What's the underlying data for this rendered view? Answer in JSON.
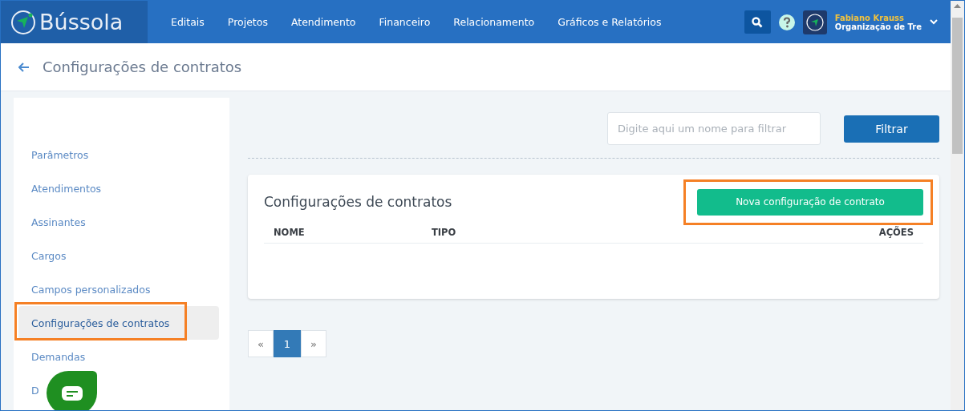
{
  "brand": "Bússola",
  "nav": [
    {
      "label": "Editais"
    },
    {
      "label": "Projetos"
    },
    {
      "label": "Atendimento"
    },
    {
      "label": "Financeiro"
    },
    {
      "label": "Relacionamento"
    },
    {
      "label": "Gráficos e Relatórios"
    }
  ],
  "user": {
    "name": "Fabiano Krauss",
    "organization": "Organização de Tre"
  },
  "page_title": "Configurações de contratos",
  "sidebar": {
    "items": [
      {
        "label": "Parâmetros",
        "selected": false,
        "highlighted": false
      },
      {
        "label": "Atendimentos",
        "selected": false,
        "highlighted": false
      },
      {
        "label": "Assinantes",
        "selected": false,
        "highlighted": false
      },
      {
        "label": "Cargos",
        "selected": false,
        "highlighted": false
      },
      {
        "label": "Campos personalizados",
        "selected": false,
        "highlighted": false
      },
      {
        "label": "Configurações de contratos",
        "selected": true,
        "highlighted": true
      },
      {
        "label": "Demandas",
        "selected": false,
        "highlighted": false
      },
      {
        "label": "D",
        "selected": false,
        "highlighted": false
      }
    ]
  },
  "filter": {
    "placeholder": "Digite aqui um nome para filtrar",
    "button": "Filtrar"
  },
  "card": {
    "title": "Configurações de contratos",
    "new_button": {
      "label": "Nova configuração de contrato",
      "highlighted": true
    },
    "columns": [
      "NOME",
      "TIPO",
      "AÇÕES"
    ]
  },
  "pagination": [
    {
      "label": "«",
      "selected": false
    },
    {
      "label": "1",
      "selected": true
    },
    {
      "label": "»",
      "selected": false
    }
  ]
}
